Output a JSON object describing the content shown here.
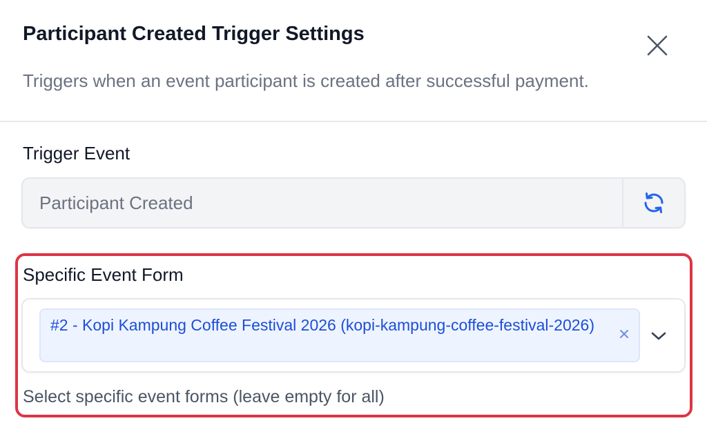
{
  "header": {
    "title": "Participant Created Trigger Settings",
    "subtitle": "Triggers when an event participant is created after successful payment.",
    "close_icon": "close-icon"
  },
  "trigger_event": {
    "label": "Trigger Event",
    "value": "Participant Created",
    "refresh_icon": "refresh-icon"
  },
  "event_form": {
    "label": "Specific Event Form",
    "selected": [
      {
        "label": "#2 - Kopi Kampung Coffee Festival 2026 (kopi-kampung-coffee-festival-2026)"
      }
    ],
    "remove_icon": "remove-x-icon",
    "dropdown_icon": "chevron-down-icon",
    "help_text": "Select specific event forms (leave empty for all)"
  },
  "colors": {
    "highlight_border": "#dc3545",
    "chip_background": "#eef4ff",
    "chip_text": "#1d4ed8",
    "refresh_icon": "#2563eb",
    "muted_text": "#6b7280"
  }
}
